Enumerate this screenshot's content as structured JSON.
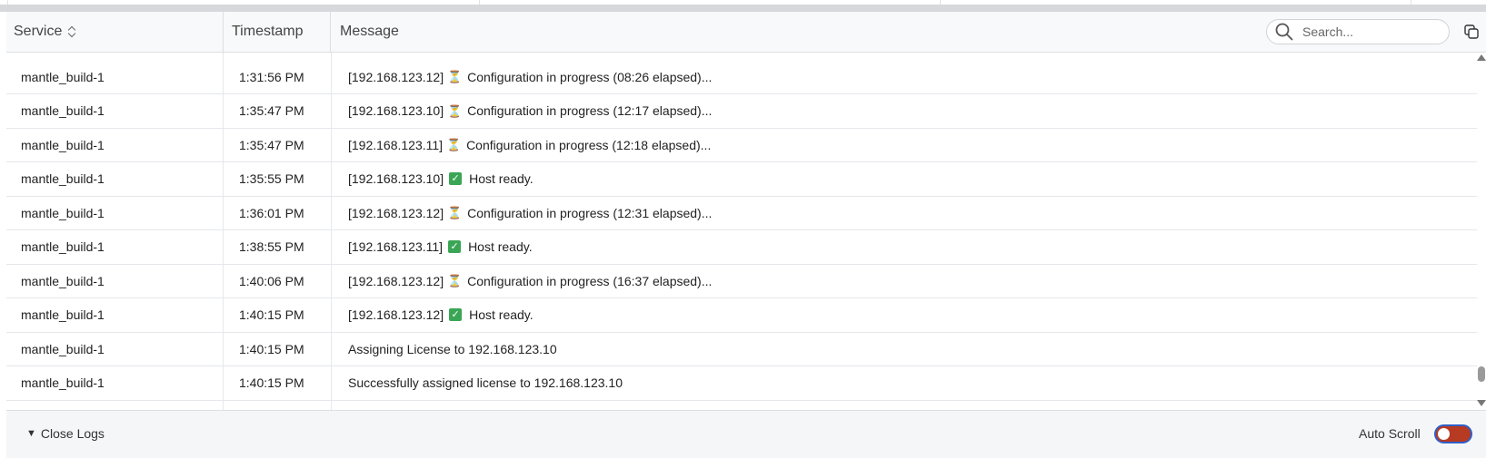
{
  "header": {
    "service": "Service",
    "timestamp": "Timestamp",
    "message": "Message",
    "search_placeholder": "Search..."
  },
  "rows": [
    {
      "service": "mantle_build-1",
      "timestamp": "1:31:56 PM",
      "prefix": "[192.168.123.12]",
      "icon": "hourglass-icon",
      "text": "Configuration in progress (08:26 elapsed)..."
    },
    {
      "service": "mantle_build-1",
      "timestamp": "1:35:47 PM",
      "prefix": "[192.168.123.10]",
      "icon": "hourglass-icon",
      "text": "Configuration in progress (12:17 elapsed)..."
    },
    {
      "service": "mantle_build-1",
      "timestamp": "1:35:47 PM",
      "prefix": "[192.168.123.11]",
      "icon": "hourglass-icon",
      "text": "Configuration in progress (12:18 elapsed)..."
    },
    {
      "service": "mantle_build-1",
      "timestamp": "1:35:55 PM",
      "prefix": "[192.168.123.10]",
      "icon": "check-icon",
      "text": "Host ready."
    },
    {
      "service": "mantle_build-1",
      "timestamp": "1:36:01 PM",
      "prefix": "[192.168.123.12]",
      "icon": "hourglass-icon",
      "text": "Configuration in progress (12:31 elapsed)..."
    },
    {
      "service": "mantle_build-1",
      "timestamp": "1:38:55 PM",
      "prefix": "[192.168.123.11]",
      "icon": "check-icon",
      "text": "Host ready."
    },
    {
      "service": "mantle_build-1",
      "timestamp": "1:40:06 PM",
      "prefix": "[192.168.123.12]",
      "icon": "hourglass-icon",
      "text": "Configuration in progress (16:37 elapsed)..."
    },
    {
      "service": "mantle_build-1",
      "timestamp": "1:40:15 PM",
      "prefix": "[192.168.123.12]",
      "icon": "check-icon",
      "text": "Host ready."
    },
    {
      "service": "mantle_build-1",
      "timestamp": "1:40:15 PM",
      "prefix": "",
      "icon": "",
      "text": "Assigning License to 192.168.123.10"
    },
    {
      "service": "mantle_build-1",
      "timestamp": "1:40:15 PM",
      "prefix": "",
      "icon": "",
      "text": "Successfully assigned license to 192.168.123.10"
    }
  ],
  "footer": {
    "close_logs": "Close Logs",
    "auto_scroll": "Auto Scroll",
    "auto_scroll_on": false
  },
  "colors": {
    "toggle_bg": "#b73a22",
    "toggle_border": "#2f5fc8",
    "check_green": "#3aa655"
  }
}
